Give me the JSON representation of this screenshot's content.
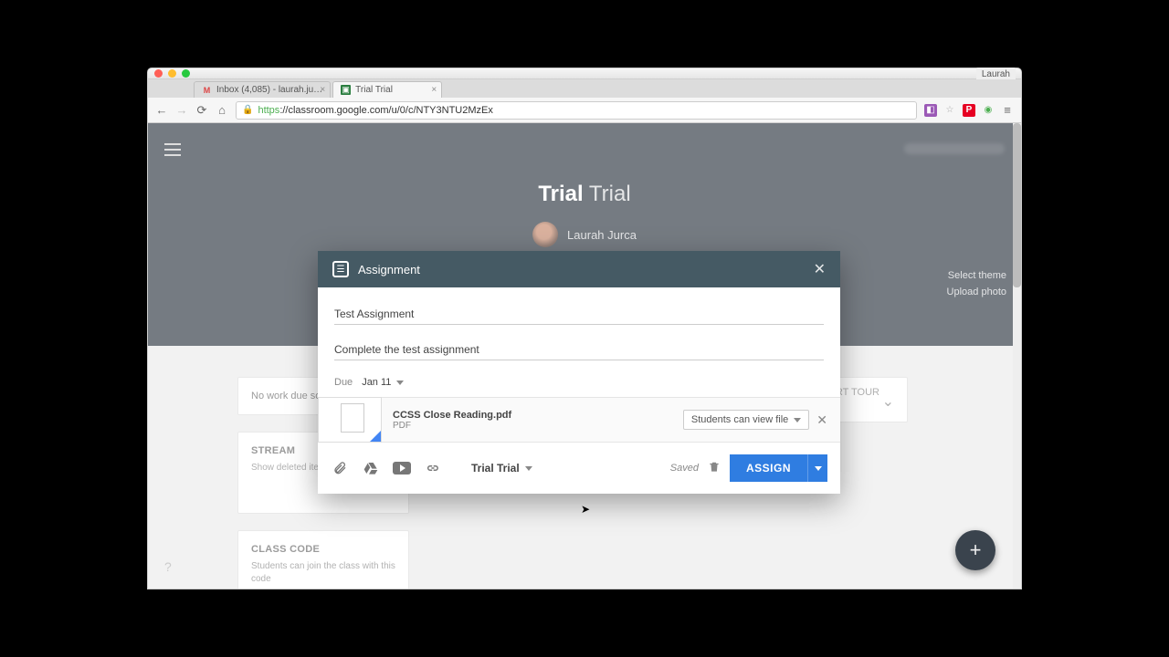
{
  "browser": {
    "user_badge": "Laurah",
    "tabs": [
      {
        "label": "Inbox (4,085) - laurah.ju…",
        "active": false,
        "favicon": "gmail"
      },
      {
        "label": "Trial Trial",
        "active": true,
        "favicon": "classroom"
      }
    ],
    "url": "https://classroom.google.com/u/0/c/NTY3NTU2MzEx",
    "url_display_host": "classroom.google.com",
    "url_display_path": "/u/0/c/NTY3NTU2MzEx"
  },
  "classroom": {
    "class_name_bold": "Trial",
    "class_name_rest": "Trial",
    "teacher_name": "Laurah Jurca",
    "hero_links": {
      "select_theme": "Select theme",
      "upload_photo": "Upload photo"
    },
    "no_work": "No work due soo",
    "stream_heading": "STREAM",
    "stream_sub": "Show deleted item",
    "classcode_heading": "CLASS CODE",
    "classcode_sub": "Students can join the class with this code",
    "start_tour": "START TOUR",
    "help": "?",
    "fab": "+"
  },
  "dialog": {
    "header": "Assignment",
    "title_value": "Test Assignment",
    "instructions_value": "Complete the test assignment",
    "due_label": "Due",
    "due_value": "Jan 11",
    "attachment": {
      "name": "CCSS Close Reading.pdf",
      "type": "PDF",
      "permission": "Students can view file"
    },
    "class_selector": "Trial Trial",
    "saved_label": "Saved",
    "assign_label": "ASSIGN"
  }
}
